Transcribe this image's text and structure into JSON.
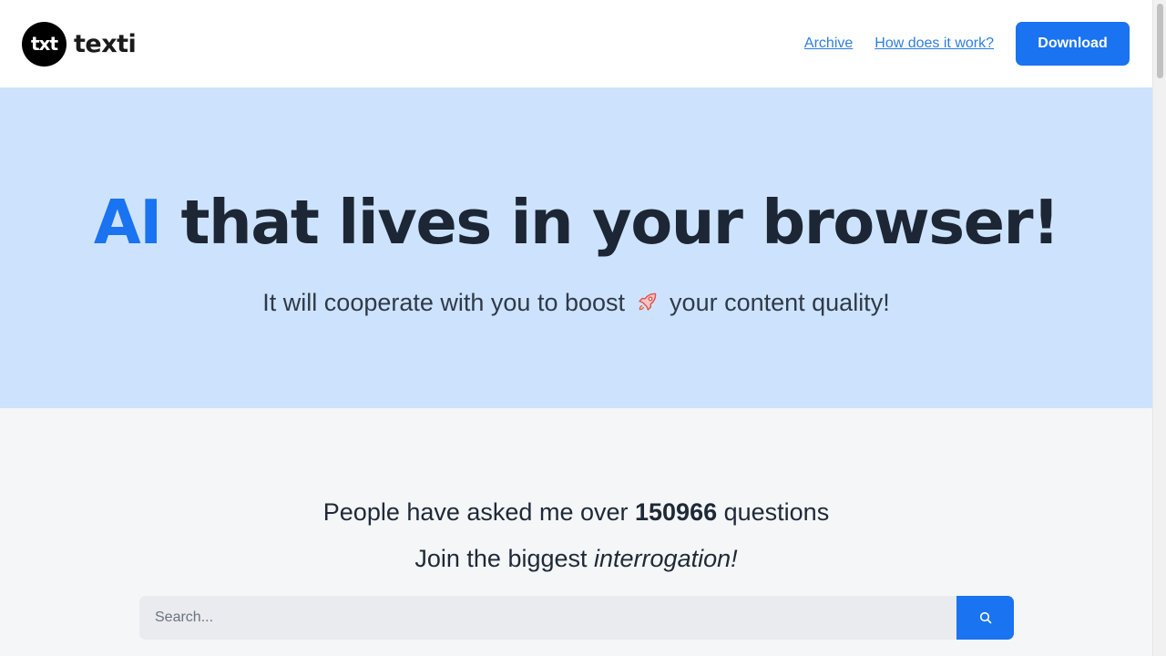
{
  "header": {
    "logo_text": "txt",
    "brand_name": "texti",
    "nav": {
      "archive": "Archive",
      "how_it_works": "How does it work?"
    },
    "download_label": "Download"
  },
  "hero": {
    "title_accent": "AI",
    "title_rest": " that lives in your browser!",
    "subtitle_before": "It will cooperate with you to boost",
    "subtitle_icon": "rocket-icon",
    "subtitle_after": "your content quality!"
  },
  "stats": {
    "line1_before": "People have asked me over ",
    "question_count": "150966",
    "line1_after": " questions",
    "line2_before": "Join the biggest ",
    "line2_emphasis": "interrogation!"
  },
  "search": {
    "placeholder": "Search...",
    "button_icon": "search-icon"
  },
  "colors": {
    "accent": "#1a73f0",
    "hero_bg": "#cde3fd",
    "page_bg": "#f4f6f8"
  }
}
